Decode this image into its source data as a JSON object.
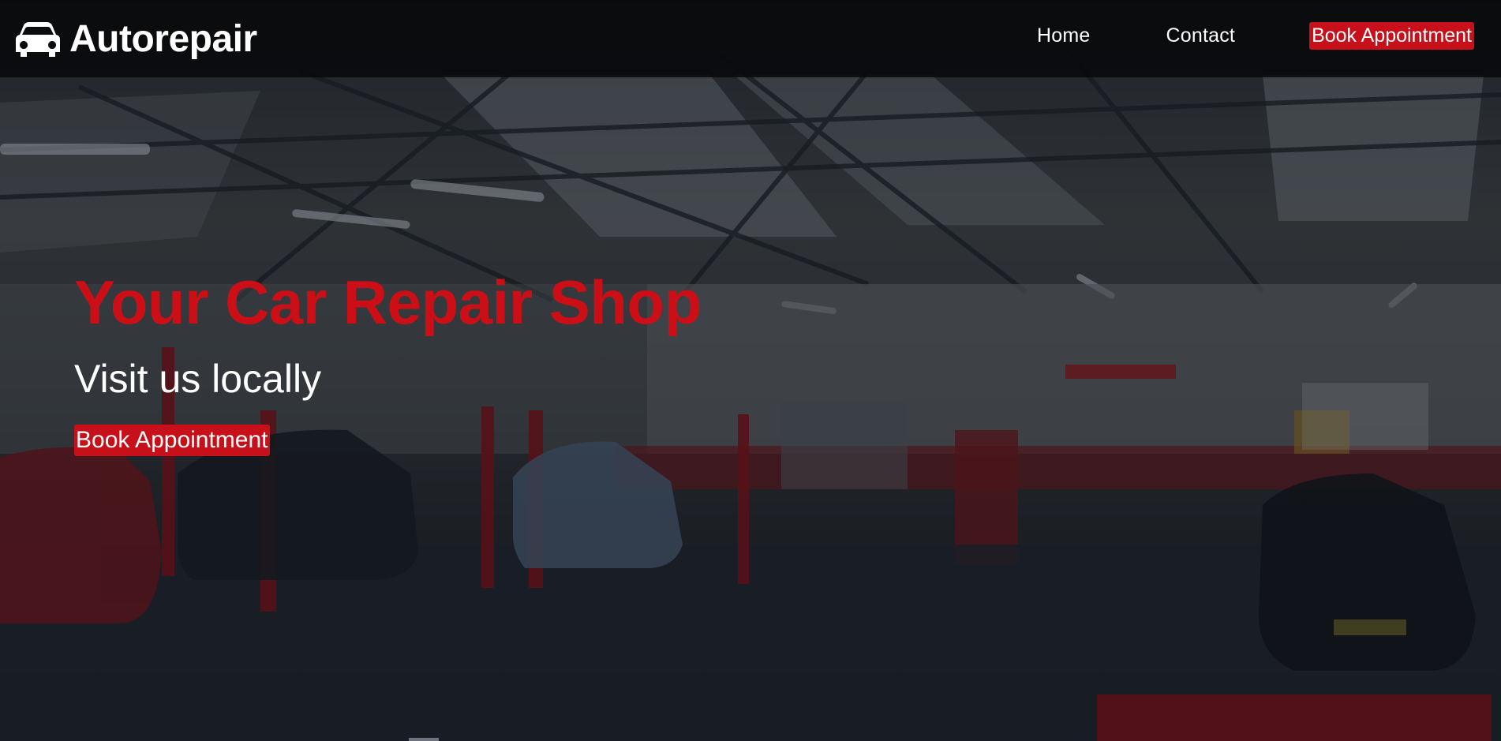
{
  "brand": {
    "name": "Autorepair",
    "icon": "car-icon"
  },
  "nav": {
    "home_label": "Home",
    "contact_label": "Contact",
    "cta_label": "Book Appointment"
  },
  "hero": {
    "title": "Your Car Repair Shop",
    "subtitle": "Visit us locally",
    "cta_label": "Book Appointment",
    "background": "garage-workshop-photo"
  },
  "colors": {
    "accent": "#c8101a",
    "navbar": "#08090b",
    "text": "#ffffff"
  }
}
